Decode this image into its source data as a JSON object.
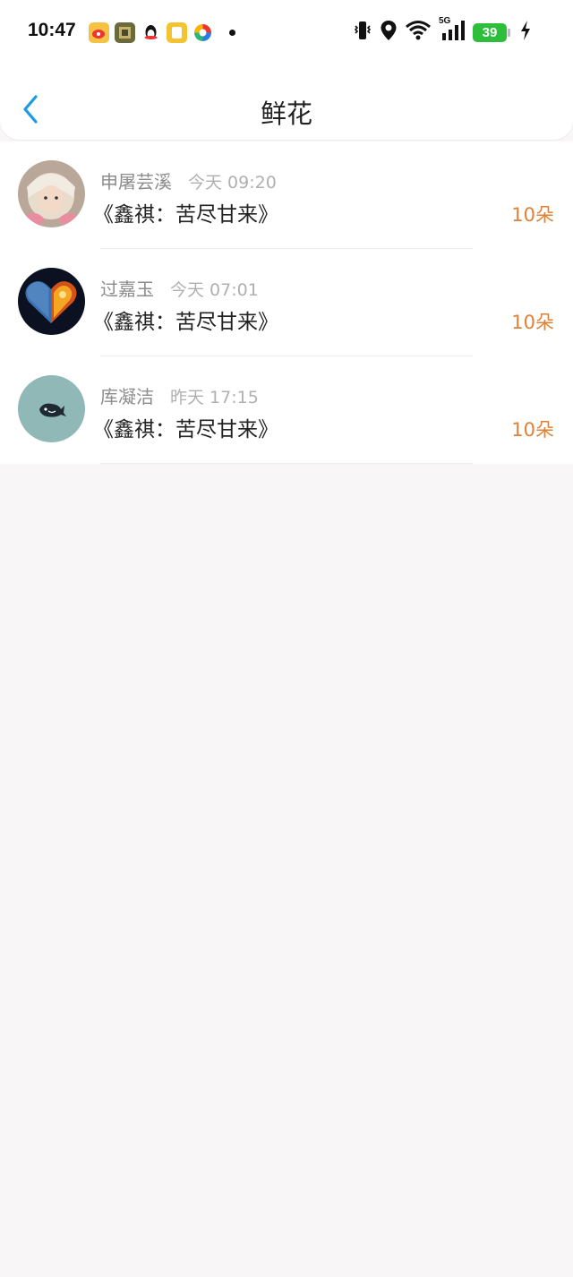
{
  "status_bar": {
    "time": "10:47",
    "network": "5G",
    "battery": "39",
    "app_icons": [
      "weibo-icon",
      "game-icon",
      "qq-icon",
      "notes-icon",
      "app-icon"
    ],
    "sys_icons": [
      "vibrate-icon",
      "location-icon",
      "wifi-icon",
      "signal-icon",
      "battery-icon",
      "charging-icon"
    ]
  },
  "header": {
    "title": "鲜花",
    "back_icon": "chevron-left-icon",
    "accent_color": "#1a9be6"
  },
  "list": {
    "items": [
      {
        "name": "申屠芸溪",
        "time": "今天 09:20",
        "book": "《鑫祺：苦尽甘来》",
        "count": "10朵"
      },
      {
        "name": "过嘉玉",
        "time": "今天 07:01",
        "book": "《鑫祺：苦尽甘来》",
        "count": "10朵"
      },
      {
        "name": "库凝洁",
        "time": "昨天 17:15",
        "book": "《鑫祺：苦尽甘来》",
        "count": "10朵"
      }
    ],
    "count_color": "#e0813a"
  }
}
